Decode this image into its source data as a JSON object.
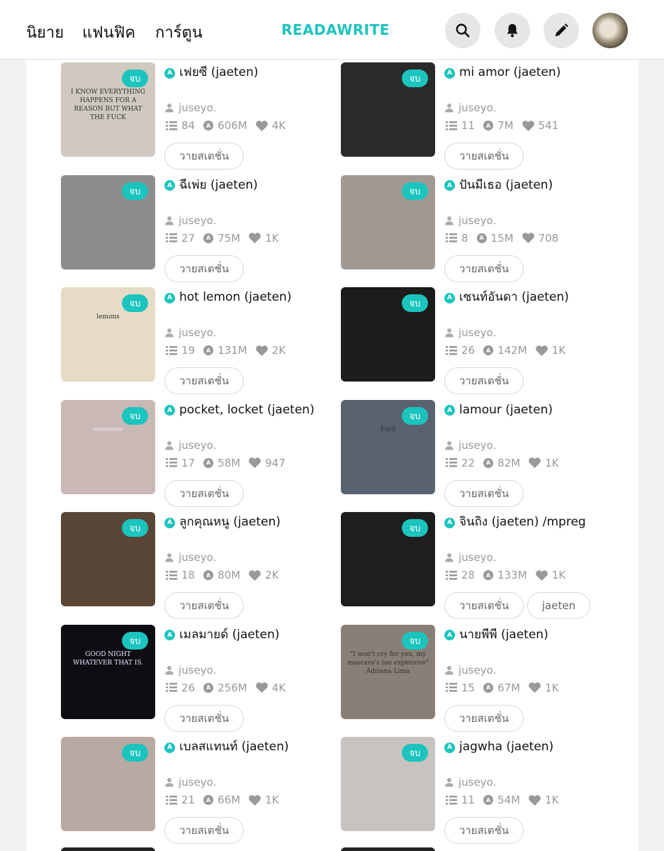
{
  "nav": {
    "novels": "นิยาย",
    "fanfic": "แฟนฟิค",
    "cartoon": "การ์ตูน"
  },
  "logo": "READAWRITE",
  "completed_badge": "จบ",
  "author": "juseyo.",
  "tag_primary": "วายสเตชั่น",
  "stories": [
    {
      "title": "เฟยซี (jaeten)",
      "chapters": "84",
      "views": "606M",
      "likes": "4K",
      "thumb_color": "#cfc9c0",
      "thumb_text": "I KNOW EVERYTHING HAPPENS FOR A REASON BUT WHAT THE FUCK"
    },
    {
      "title": "mi amor (jaeten)",
      "chapters": "11",
      "views": "7M",
      "likes": "541",
      "thumb_color": "#2a2a2a"
    },
    {
      "title": "ฉีเพ่ย (jaeten)",
      "chapters": "27",
      "views": "75M",
      "likes": "1K",
      "thumb_color": "#8d8d8d"
    },
    {
      "title": "ปันมีเธอ (jaeten)",
      "chapters": "8",
      "views": "15M",
      "likes": "708",
      "thumb_color": "#a09a92"
    },
    {
      "title": "hot lemon (jaeten)",
      "chapters": "19",
      "views": "131M",
      "likes": "2K",
      "thumb_color": "#e6dcc6",
      "thumb_text": "lemons"
    },
    {
      "title": "เซนท์อันดา (jaeten)",
      "chapters": "26",
      "views": "142M",
      "likes": "1K",
      "thumb_color": "#1d1c1b"
    },
    {
      "title": "pocket, locket (jaeten)",
      "chapters": "17",
      "views": "58M",
      "likes": "947",
      "thumb_color": "#c9b8b6",
      "thumb_text": "nonsense"
    },
    {
      "title": "lamour (jaeten)",
      "chapters": "22",
      "views": "82M",
      "likes": "1K",
      "thumb_color": "#5a6270",
      "thumb_text": "Ford"
    },
    {
      "title": "ลูกคุณหนู (jaeten)",
      "chapters": "18",
      "views": "80M",
      "likes": "2K",
      "thumb_color": "#5a4636"
    },
    {
      "title": "จินถิง (jaeten) /mpreg",
      "chapters": "28",
      "views": "133M",
      "likes": "1K",
      "thumb_color": "#1e1e1e",
      "extra_tag": "jaeten"
    },
    {
      "title": "เมลมายด์ (jaeten)",
      "chapters": "26",
      "views": "256M",
      "likes": "4K",
      "thumb_color": "#0d0d12",
      "thumb_text": "GOOD NIGHT WHATEVER THAT IS."
    },
    {
      "title": "นายพีพี (jaeten)",
      "chapters": "15",
      "views": "67M",
      "likes": "1K",
      "thumb_color": "#8a7f78",
      "thumb_text": "\"I won't cry for you, my mascara's too expensive\" Adriana Lima"
    },
    {
      "title": "เบลสแทนท์ (jaeten)",
      "chapters": "21",
      "views": "66M",
      "likes": "1K",
      "thumb_color": "#b8a9a2"
    },
    {
      "title": "jagwha (jaeten)",
      "chapters": "11",
      "views": "54M",
      "likes": "1K",
      "thumb_color": "#c7c3c0"
    }
  ]
}
